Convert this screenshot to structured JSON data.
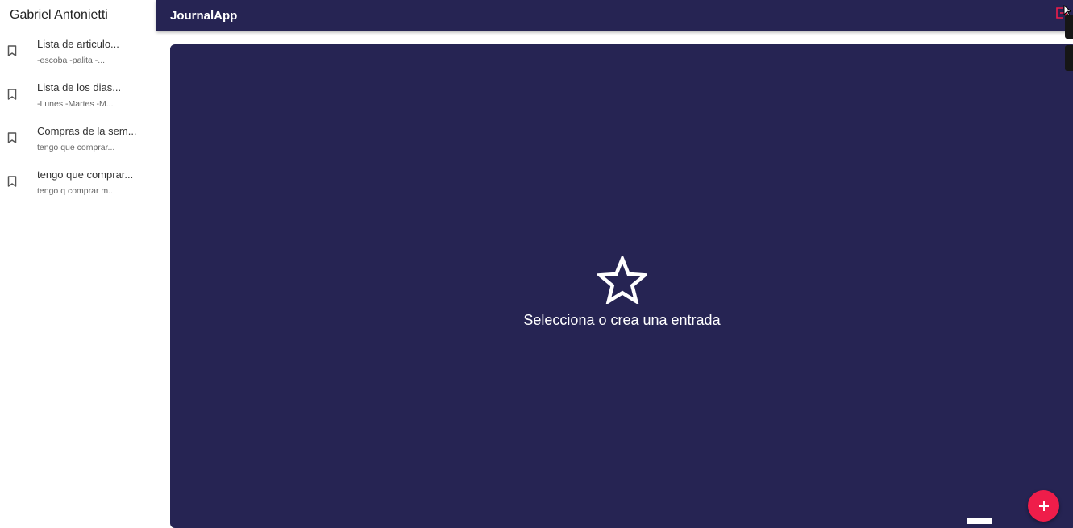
{
  "sidebar": {
    "user_name": "Gabriel Antonietti",
    "entries": [
      {
        "title": "Lista de articulo...",
        "preview": "-escoba -palita -..."
      },
      {
        "title": "Lista de los dias...",
        "preview": "-Lunes -Martes -M..."
      },
      {
        "title": "Compras de la sem...",
        "preview": "tengo que comprar..."
      },
      {
        "title": "tengo que comprar...",
        "preview": "tengo q comprar m..."
      }
    ]
  },
  "topbar": {
    "app_title": "JournalApp",
    "logout_icon": "logout-icon"
  },
  "main": {
    "empty_icon": "star-outline-icon",
    "empty_message": "Selecciona o crea una entrada"
  },
  "fab": {
    "icon": "add-icon"
  },
  "colors": {
    "primary": "#262453",
    "accent": "#ef1d4a"
  }
}
